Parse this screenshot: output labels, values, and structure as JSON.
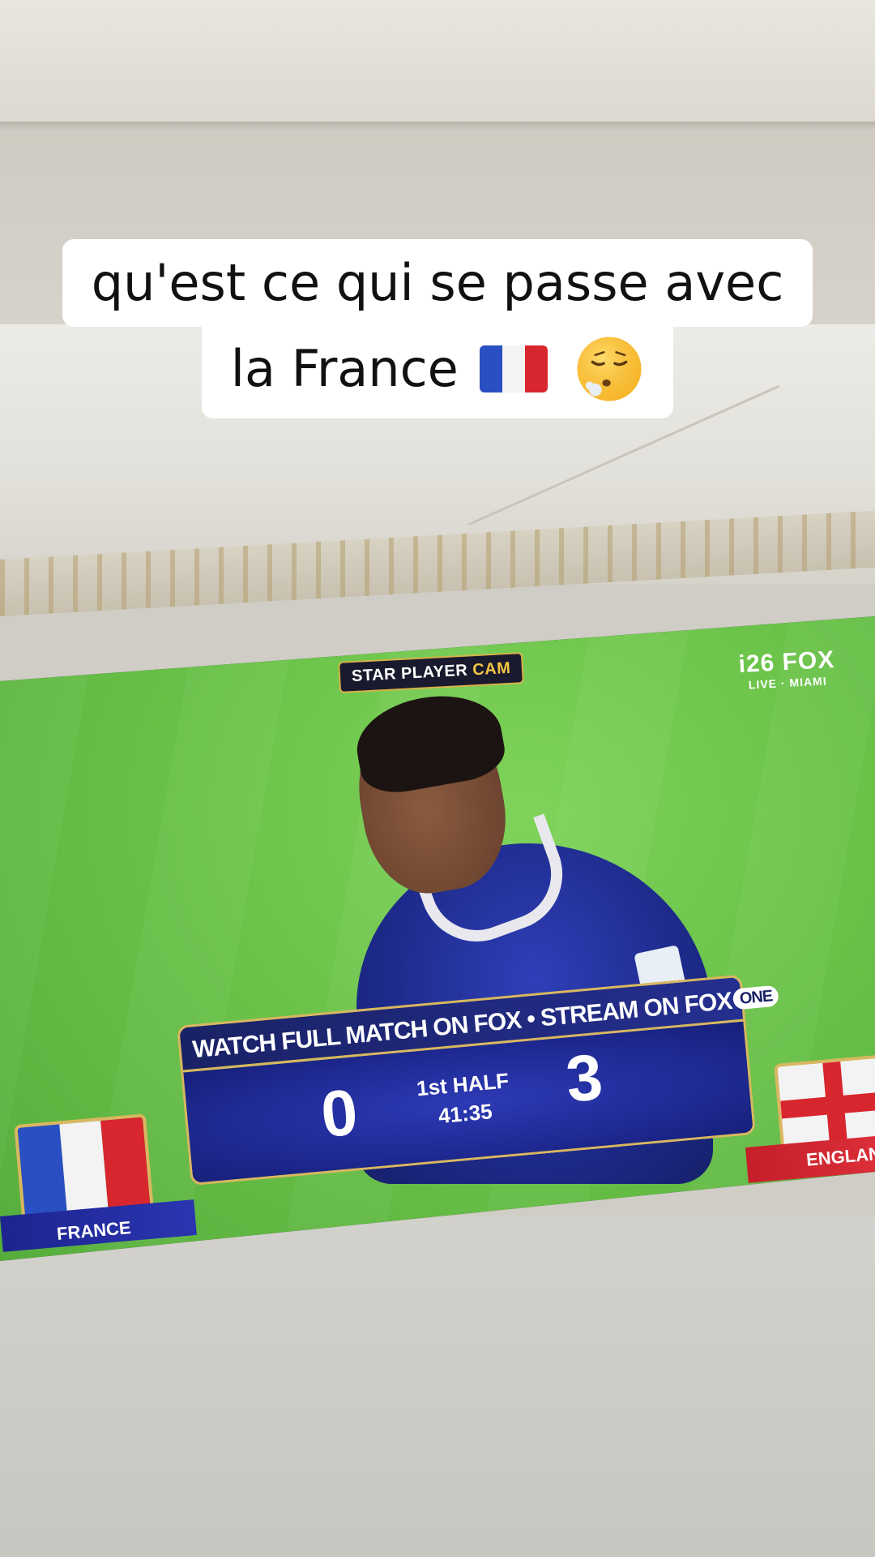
{
  "caption": {
    "line1": "qu'est ce qui se passe avec",
    "line2": "la France"
  },
  "broadcast": {
    "cam_label_primary": "STAR PLAYER",
    "cam_label_accent": "CAM",
    "channel_name": "i26 FOX",
    "channel_sub": "LIVE · MIAMI"
  },
  "scoreboard": {
    "banner_text": "WATCH FULL MATCH ON FOX • STREAM ON FOX",
    "banner_pill": "ONE",
    "home_score": "0",
    "away_score": "3",
    "period": "1st HALF",
    "clock": "41:35",
    "home_team": "FRANCE",
    "away_team": "ENGLAND"
  },
  "colors": {
    "scoreboard_blue": "#1f2a95",
    "scoreboard_gold": "#d9b760",
    "pitch_green": "#6cc44a"
  },
  "icons": {
    "caption_flag": "france-flag-emoji",
    "caption_face": "exhaling-face-emoji"
  }
}
